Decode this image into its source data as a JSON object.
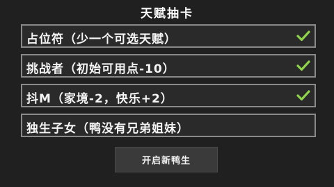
{
  "title": "天赋抽卡",
  "talents": [
    {
      "label": "占位符（少一个可选天赋）",
      "checked": true
    },
    {
      "label": "挑战者（初始可用点-10）",
      "checked": true
    },
    {
      "label": "抖M（家境-2，快乐+2）",
      "checked": true
    },
    {
      "label": "独生子女（鸭没有兄弟姐妹）",
      "checked": false
    }
  ],
  "start_button": "开启新鸭生",
  "colors": {
    "check": "#8ed34a",
    "row_border": "#8a8a8a",
    "background": "#202020"
  }
}
